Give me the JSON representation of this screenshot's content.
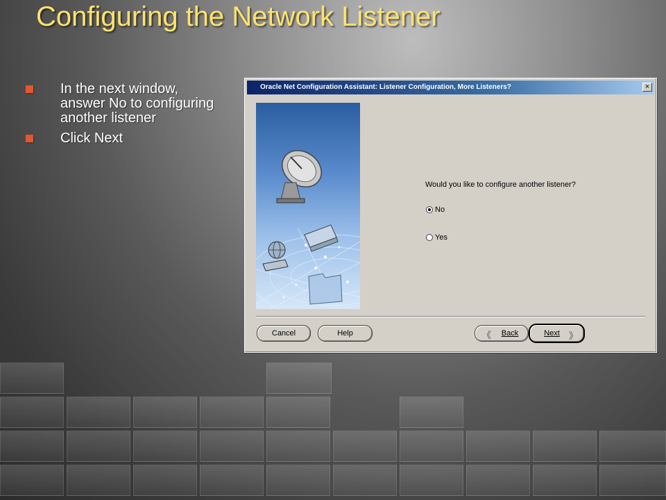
{
  "slide": {
    "title": "Configuring the Network Listener",
    "bullets": [
      "In the next window, answer No to configuring another listener",
      "Click Next"
    ]
  },
  "dialog": {
    "title": "Oracle Net Configuration Assistant: Listener Configuration, More Listeners?",
    "close_glyph": "×",
    "question": "Would you like to configure another listener?",
    "options": [
      {
        "label": "No",
        "selected": true
      },
      {
        "label": "Yes",
        "selected": false
      }
    ],
    "buttons": {
      "cancel": "Cancel",
      "help": "Help",
      "back": "Back",
      "next": "Next"
    }
  },
  "icons": {
    "satellite": "satellite-dish-icon",
    "globe": "globe-icon",
    "folder": "folder-icon"
  },
  "colors": {
    "title": "#ffe36b",
    "bullet": "#e4572e",
    "dialog_bg": "#d4d0c8",
    "titlebar": "#0a246a"
  }
}
